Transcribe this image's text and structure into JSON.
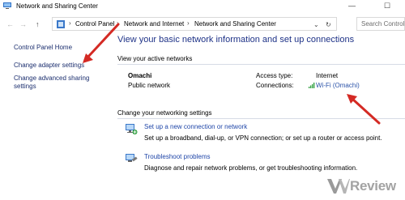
{
  "window": {
    "title": "Network and Sharing Center",
    "minimize_glyph": "—",
    "maximize_glyph": "☐"
  },
  "addressbar": {
    "back_glyph": "←",
    "forward_glyph": "→",
    "up_glyph": "↑",
    "crumbs": [
      "Control Panel",
      "Network and Internet",
      "Network and Sharing Center"
    ],
    "separator_glyph": "›",
    "dropdown_glyph": "⌄",
    "refresh_glyph": "↻",
    "search_placeholder": "Search Control"
  },
  "leftpane": {
    "home_link": "Control Panel Home",
    "adapter_link": "Change adapter settings",
    "sharing_link_line1": "Change advanced sharing",
    "sharing_link_line2": "settings"
  },
  "main": {
    "heading": "View your basic network information and set up connections",
    "active_networks_title": "View your active networks",
    "network": {
      "name": "Omachi",
      "type": "Public network",
      "access_type_label": "Access type:",
      "access_type_value": "Internet",
      "connections_label": "Connections:",
      "connection_link": "Wi-Fi (Omachi)"
    },
    "change_settings_title": "Change your networking settings",
    "tasks": [
      {
        "link": "Set up a new connection or network",
        "description": "Set up a broadband, dial-up, or VPN connection; or set up a router or access point."
      },
      {
        "link": "Troubleshoot problems",
        "description": "Diagnose and repair network problems, or get troubleshooting information."
      }
    ]
  },
  "watermark": {
    "text": "Review"
  },
  "colors": {
    "link": "#1f46a8",
    "heading": "#1e3287",
    "annotation_arrow": "#d42a24",
    "signal_green": "#2e9e3e"
  }
}
